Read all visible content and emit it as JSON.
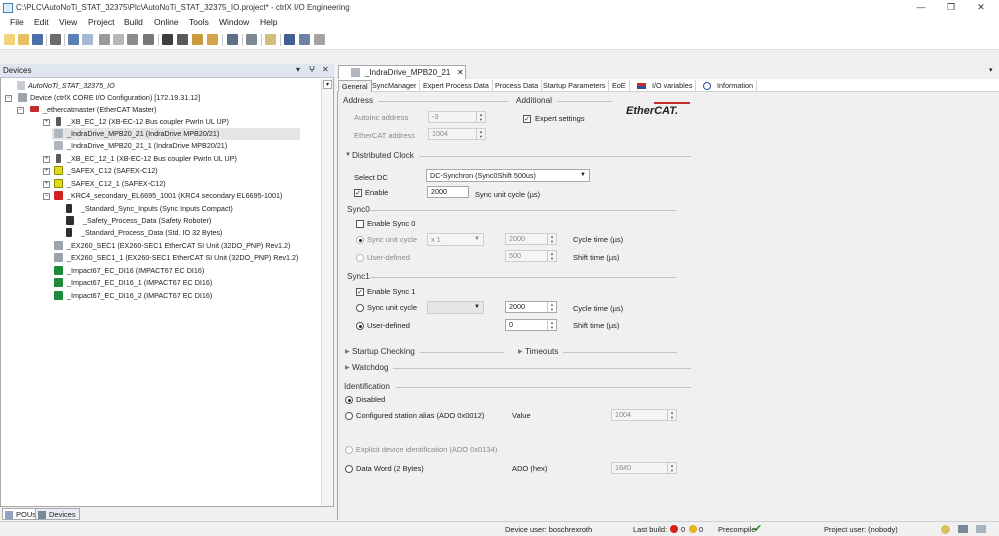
{
  "window": {
    "title": "C:\\PLC\\AutoNoTi_STAT_32375\\Plc\\AutoNoTi_STAT_32375_IO.project* - ctrlX I/O Engineering",
    "minimize": "—",
    "maximize": "❐",
    "close": "✕"
  },
  "menu": [
    "File",
    "Edit",
    "View",
    "Project",
    "Build",
    "Online",
    "Tools",
    "Window",
    "Help"
  ],
  "devices_panel": {
    "title": "Devices",
    "pin": "▾",
    "pin2": "ⵖ",
    "close": "✕",
    "tree": [
      {
        "label": "AutoNoTi_STAT_32375_IO",
        "italic": true
      },
      {
        "label": "Device (ctrlX CORE I/O Configuration) [172.19.31.12]"
      },
      {
        "label": "_ethercatmaster (EtherCAT Master)"
      },
      {
        "label": "_XB_EC_12 (XB-EC-12 Bus coupler PwrIn UL UP)"
      },
      {
        "label": "_IndraDrive_MPB20_21 (IndraDrive MPB20/21)"
      },
      {
        "label": "_IndraDrive_MPB20_21_1 (IndraDrive MPB20/21)"
      },
      {
        "label": "_XB_EC_12_1 (XB-EC-12 Bus coupler PwrIn UL UP)"
      },
      {
        "label": "_SAFEX_C12 (SAFEX-C12)"
      },
      {
        "label": "_SAFEX_C12_1 (SAFEX-C12)"
      },
      {
        "label": "_KRC4_secondary_EL6695_1001 (KRC4 secondary EL6695-1001)"
      },
      {
        "label": "_Standard_Sync_Inputs (Sync Inputs Compact)"
      },
      {
        "label": "_Safety_Process_Data (Safety Roboter)"
      },
      {
        "label": "_Standard_Process_Data (Std. IO 32 Bytes)"
      },
      {
        "label": "_EX260_SEC1 (EX260-SEC1 EtherCAT SI Unit (32DO_PNP) Rev1.2)"
      },
      {
        "label": "_EX260_SEC1_1 (EX260-SEC1 EtherCAT SI Unit (32DO_PNP) Rev1.2)"
      },
      {
        "label": "_Impact67_EC_DI16 (IMPACT67 EC DI16)"
      },
      {
        "label": "_Impact67_EC_DI16_1 (IMPACT67 EC DI16)"
      },
      {
        "label": "_Impact67_EC_DI16_2 (IMPACT67 EC DI16)"
      }
    ],
    "bottom_tabs": [
      "POUs",
      "Devices"
    ]
  },
  "editor": {
    "tab_title": "_IndraDrive_MPB20_21",
    "tab_close": "✕",
    "subtabs": [
      "General",
      "SyncManager",
      "Expert Process Data",
      "Process Data",
      "Startup Parameters",
      "EoE",
      "I/O variables",
      "Information"
    ],
    "address": {
      "heading": "Address",
      "autoinc_label": "AutoInc address",
      "autoinc_value": "-3",
      "ethercat_label": "EtherCAT address",
      "ethercat_value": "1004"
    },
    "additional": {
      "heading": "Additional",
      "expert_settings": "Expert settings",
      "logo": "EtherCAT."
    },
    "dc": {
      "heading": "Distributed Clock",
      "select_label": "Select DC",
      "select_value": "DC-Synchron (Sync0Shift 500us)",
      "enable_label": "Enable",
      "cycle_value": "2000",
      "cycle_unit": "Sync unit cycle (µs)"
    },
    "sync0": {
      "heading": "Sync0",
      "enable": "Enable Sync 0",
      "unit_cycle": "Sync unit cycle",
      "mult": "x 1",
      "cycle_value": "2000",
      "cycle_label": "Cycle time (µs)",
      "user_defined": "User-defined",
      "shift_value": "500",
      "shift_label": "Shift time (µs)"
    },
    "sync1": {
      "heading": "Sync1",
      "enable": "Enable Sync 1",
      "unit_cycle": "Sync unit cycle",
      "cycle_value": "2000",
      "cycle_label": "Cycle time (µs)",
      "user_defined": "User-defined",
      "shift_value": "0",
      "shift_label": "Shift time (µs)"
    },
    "startup": "Startup Checking",
    "timeouts": "Timeouts",
    "watchdog": "Watchdog",
    "identification": {
      "heading": "Identification",
      "disabled": "Disabled",
      "alias": "Configured station alias (ADO 0x0012)",
      "value_label": "Value",
      "value": "1004",
      "explicit": "Explicit device identification (ADO 0x0134)",
      "data_word": "Data Word (2 Bytes)",
      "ado_label": "ADO (hex)",
      "ado_value": "16#0"
    }
  },
  "status": {
    "device_user": "Device user: boschrexroth",
    "last_build": "Last build:",
    "errors": "0",
    "warnings": "0",
    "precompile": "Precompile",
    "project_user": "Project user: (nobody)"
  }
}
